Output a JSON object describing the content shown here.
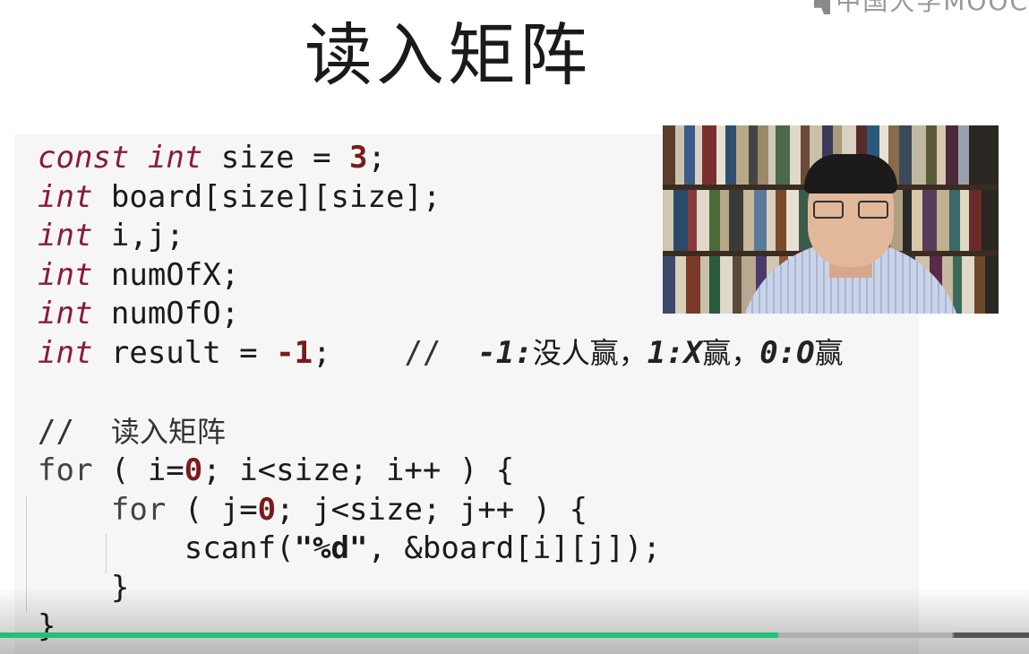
{
  "branding": {
    "logo_text": "中国大学MOOC",
    "logo_icon": "mooc-logo-icon"
  },
  "slide": {
    "title": "读入矩阵",
    "code": {
      "line1": {
        "kw1": "const",
        "kw2": "int",
        "rest": " size = ",
        "num": "3",
        "end": ";"
      },
      "line2": {
        "kw": "int",
        "rest": " board[size][size];"
      },
      "line3": {
        "kw": "int",
        "rest": " i,j;"
      },
      "line4": {
        "kw": "int",
        "rest": " numOfX;"
      },
      "line5": {
        "kw": "int",
        "rest": " numOfO;"
      },
      "line6": {
        "kw": "int",
        "rest": " result = ",
        "num": "-1",
        "end": ";",
        "comment_prefix": "    //  ",
        "c1": "-1:",
        "c1_text": "没人赢，",
        "c2": "1:X",
        "c2_text": "赢，",
        "c3": "0:O",
        "c3_text": "赢"
      },
      "line8": {
        "slashes": "//  ",
        "text": "读入矩阵"
      },
      "line9": {
        "kw": "for",
        "a": " ( i=",
        "num": "0",
        "b": "; i<size; i++ ) {"
      },
      "line10": {
        "indent": "    ",
        "kw": "for",
        "a": " ( j=",
        "num": "0",
        "b": "; j<size; j++ ) {"
      },
      "line11": {
        "indent": "        ",
        "a": "scanf(",
        "str": "\"%d\"",
        "b": ", &board[i][j]);"
      },
      "line12": {
        "indent": "    ",
        "a": "}"
      },
      "line13": {
        "a": "}"
      }
    }
  },
  "video": {
    "presenter_thumbnail": "presenter-video-thumbnail",
    "progress_played": 0.756,
    "progress_buffered": 0.925
  },
  "colors": {
    "keyword": "#8b1a3a",
    "number": "#7a1a1a",
    "progress": "#20c07a",
    "code_bg": "#f6f6f6"
  }
}
